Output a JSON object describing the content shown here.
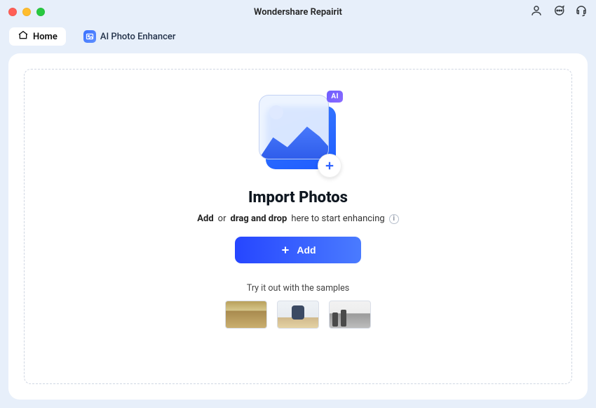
{
  "app": {
    "title": "Wondershare Repairit"
  },
  "tabs": {
    "home_label": "Home",
    "feature_label": "AI Photo Enhancer"
  },
  "main": {
    "heading": "Import Photos",
    "subtitle": {
      "add": "Add",
      "or": "or",
      "drag": "drag and drop",
      "rest": "here to start enhancing"
    },
    "illustration": {
      "ai_badge": "AI"
    },
    "add_button": "Add",
    "samples_label": "Try it out with the samples"
  },
  "icons": {
    "user": "user-icon",
    "chat": "chat-icon",
    "support": "support-icon"
  }
}
